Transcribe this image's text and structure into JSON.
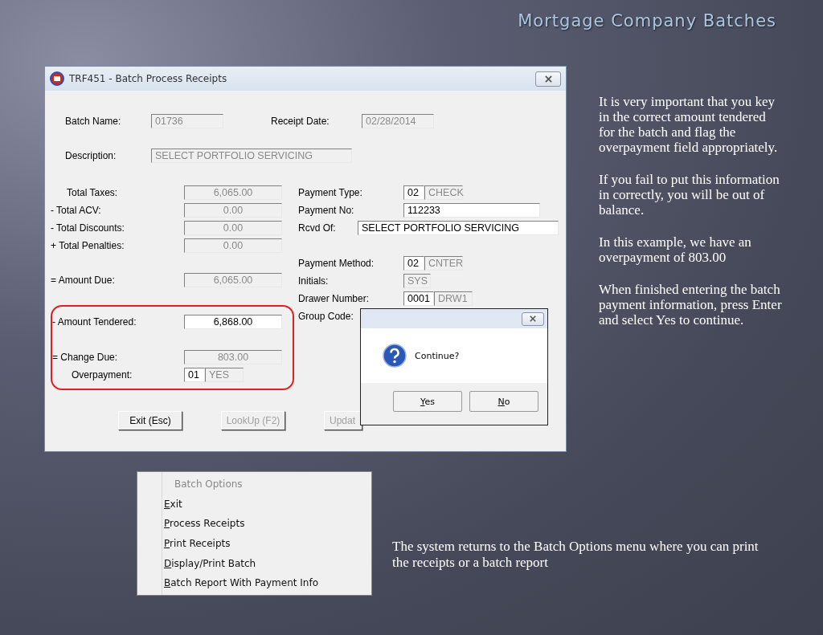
{
  "slide_title": "Mortgage Company Batches",
  "window": {
    "title": "TRF451 - Batch Process Receipts",
    "header": [
      {
        "kind": "text",
        "label": "Batch Name:",
        "value": "01736",
        "disabled": true
      },
      {
        "kind": "text",
        "label": "Receipt Date:",
        "value": "02/28/2014",
        "disabled": true
      },
      {
        "kind": "wide",
        "label": "Description:",
        "value": "SELECT PORTFOLIO SERVICING",
        "disabled": true
      }
    ],
    "left_groups": [
      [
        {
          "kind": "amount",
          "label": "Total Taxes:",
          "value": "6,065.00",
          "disabled": true
        },
        {
          "kind": "amount",
          "label": "- Total ACV:",
          "value": "0.00",
          "disabled": true
        },
        {
          "kind": "amount",
          "label": "- Total Discounts:",
          "value": "0.00",
          "disabled": true
        },
        {
          "kind": "amount",
          "label": "+ Total Penalties:",
          "value": "0.00",
          "disabled": true
        }
      ],
      [
        {
          "kind": "amount",
          "label": "= Amount Due:",
          "value": "6,065.00",
          "disabled": true
        }
      ]
    ],
    "highlighted": [
      {
        "kind": "amount",
        "label": "- Amount Tendered:",
        "value": "6,868.00",
        "disabled": false
      },
      {
        "kind": "amount",
        "label": "= Change Due:",
        "value": "803.00",
        "disabled": true
      },
      {
        "kind": "code",
        "label": "Overpayment:",
        "code": "01",
        "description": "YES"
      }
    ],
    "right_groups": [
      [
        {
          "kind": "code",
          "label": "Payment Type:",
          "code": "02",
          "description": "CHECK"
        },
        {
          "kind": "text",
          "label": "Payment No:",
          "value": "112233",
          "disabled": false
        },
        {
          "kind": "wide",
          "label": "Rcvd Of:",
          "value": "SELECT PORTFOLIO SERVICING",
          "disabled": false
        }
      ],
      [
        {
          "kind": "code",
          "label": "Payment Method:",
          "code": "02",
          "description": "CNTER"
        },
        {
          "kind": "short",
          "label": "Initials:",
          "value": "SYS",
          "disabled": true
        },
        {
          "kind": "code",
          "label": "Drawer Number:",
          "code": "0001",
          "description": "DRW1"
        },
        {
          "kind": "label",
          "label": "Group Code:"
        }
      ]
    ],
    "buttons": [
      {
        "label": "Exit (Esc)",
        "disabled": false
      },
      {
        "label": "LookUp (F2)",
        "disabled": true
      },
      {
        "label": "Updat",
        "disabled": true
      }
    ]
  },
  "dialog": {
    "message": "Continue?",
    "buttons": [
      "Yes",
      "No"
    ]
  },
  "menu": {
    "title": "Batch Options",
    "items": [
      "Exit",
      "Process Receipts",
      "Print Receipts",
      "Display/Print Batch",
      "Batch Report With Payment Info"
    ]
  },
  "notes": [
    "It is very important that you key in the correct amount tendered for the batch and flag the overpayment field appropriately.",
    "If you fail to put this information in correctly, you will be out of balance.",
    "In this example, we have an overpayment of 803.00",
    "When finished entering the batch payment information, press Enter and select Yes to continue."
  ],
  "caption": "The system returns to the Batch Options menu where you can print the receipts or a batch report"
}
